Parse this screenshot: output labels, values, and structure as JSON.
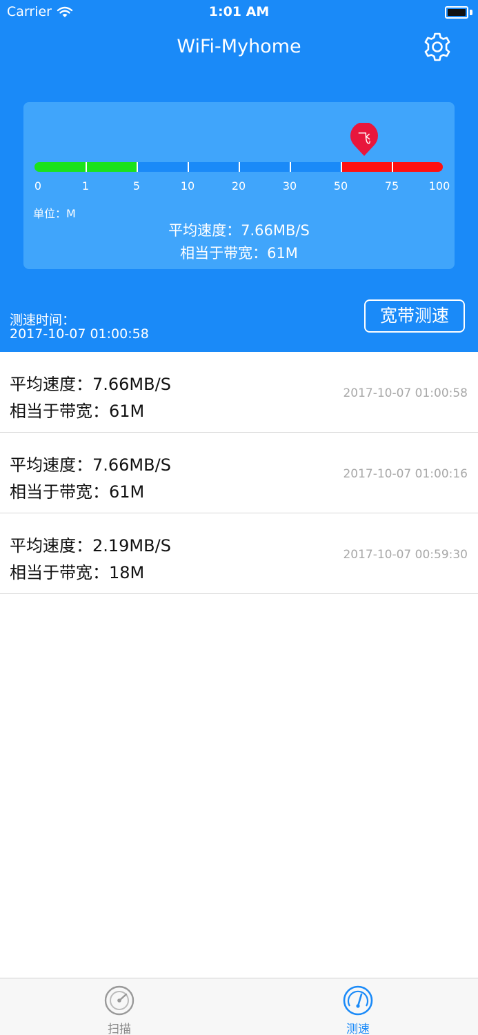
{
  "status_bar": {
    "carrier": "Carrier",
    "time": "1:01 AM"
  },
  "nav": {
    "title": "WiFi-Myhome",
    "settings_icon": "gear-icon"
  },
  "gauge": {
    "ticks": [
      "0",
      "1",
      "5",
      "10",
      "20",
      "30",
      "50",
      "75",
      "100"
    ],
    "segment_colors": {
      "green": "#1BE21B",
      "blue": "#1A8AF8",
      "red": "#FF1010"
    },
    "marker_label": "飞",
    "marker_color": "#E8163C",
    "marker_value_mbps": 61,
    "unit": "单位：M",
    "avg_speed": "平均速度：7.66MB/S",
    "bandwidth": "相当于带宽：61M"
  },
  "test": {
    "time_label": "测速时间：",
    "time_value": "2017-10-07 01:00:58",
    "button_label": "宽带测速"
  },
  "records": [
    {
      "speed": "平均速度：7.66MB/S",
      "bandwidth": "相当于带宽：61M",
      "time": "2017-10-07 01:00:58"
    },
    {
      "speed": "平均速度：7.66MB/S",
      "bandwidth": "相当于带宽：61M",
      "time": "2017-10-07 01:00:16"
    },
    {
      "speed": "平均速度：2.19MB/S",
      "bandwidth": "相当于带宽：18M",
      "time": "2017-10-07 00:59:30"
    }
  ],
  "tabbar": {
    "scan_label": "扫描",
    "scan_icon": "radar-icon",
    "speed_label": "测速",
    "speed_icon": "speedometer-icon",
    "active_tab": "测速",
    "accent": "#1A8AF8"
  },
  "colors": {
    "header_bg": "#1A8AF8",
    "card_bg": "#40A5FB"
  }
}
